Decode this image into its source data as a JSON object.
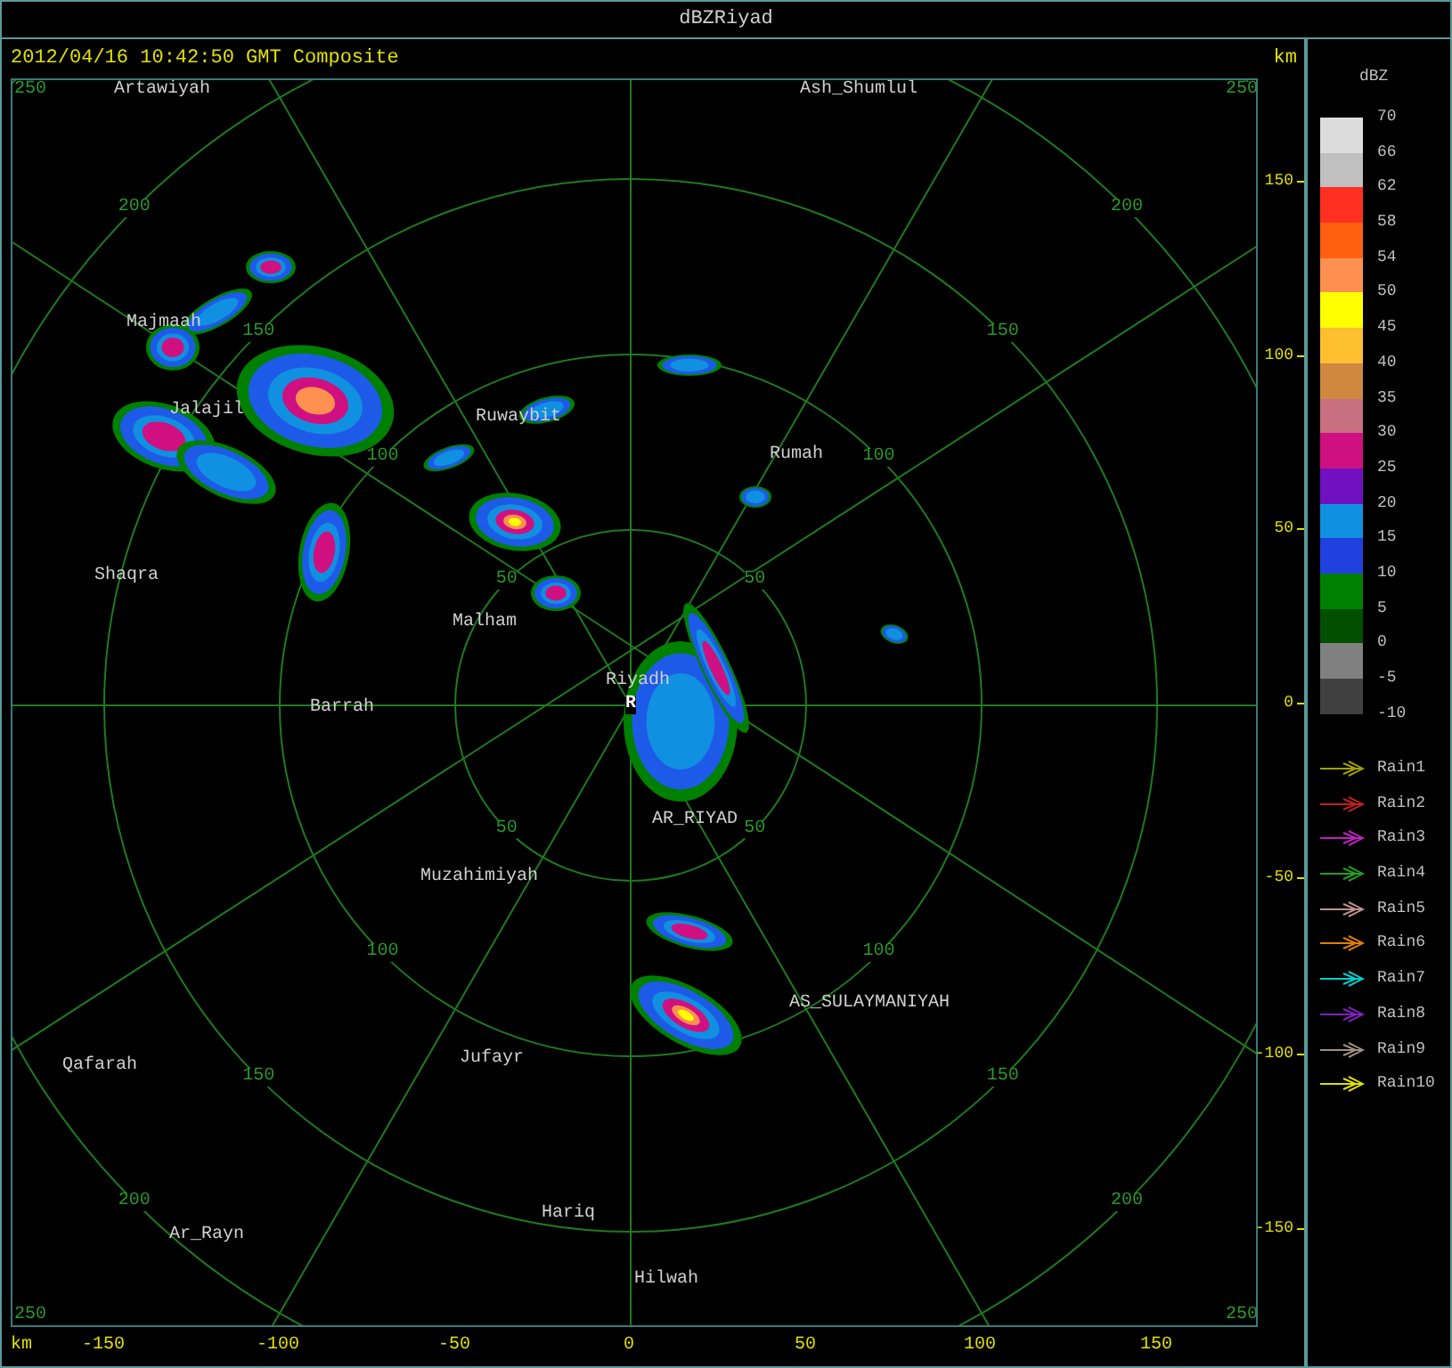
{
  "window": {
    "title": "dBZRiyad"
  },
  "header": {
    "timestamp": "2012/04/16 10:42:50 GMT Composite",
    "unit": "km"
  },
  "radar": {
    "site": "R",
    "rings": [
      {
        "labels": [
          "50",
          "50",
          "50",
          "50"
        ]
      },
      {
        "labels": [
          "100",
          "100",
          "100",
          "100"
        ]
      },
      {
        "labels": [
          "150",
          "150",
          "150",
          "150"
        ]
      },
      {
        "labels": [
          "200",
          "200",
          "200",
          "200"
        ]
      },
      {
        "labels": [
          "250",
          "250",
          "250",
          "250"
        ]
      }
    ],
    "places": [
      "Artawiyah",
      "Ash_Shumlul",
      "Majmaah",
      "Jalajil",
      "Ruwaybit",
      "Rumah",
      "Shaqra",
      "Malham",
      "Riyadh",
      "Barrah",
      "AR_RIYAD",
      "Muzahimiyah",
      "AS_SULAYMANIYAH",
      "Jufayr",
      "Qafarah",
      "Hariq",
      "Ar_Rayn",
      "Hilwah"
    ]
  },
  "y_axis": {
    "labels": [
      "150",
      "100",
      "50",
      "0",
      "-50",
      "-100",
      "-150"
    ]
  },
  "x_axis": {
    "unit": "km",
    "labels": [
      "-150",
      "-100",
      "-50",
      "0",
      "50",
      "100",
      "150"
    ]
  },
  "legend": {
    "title": "dBZ",
    "bottom_label": "-10",
    "scale": [
      {
        "label": "70",
        "color": "#dcdcdc"
      },
      {
        "label": "66",
        "color": "#c0c0c0"
      },
      {
        "label": "62",
        "color": "#ff3020"
      },
      {
        "label": "58",
        "color": "#ff6010"
      },
      {
        "label": "54",
        "color": "#ff9050"
      },
      {
        "label": "50",
        "color": "#ffff00"
      },
      {
        "label": "45",
        "color": "#ffc030"
      },
      {
        "label": "40",
        "color": "#d08840"
      },
      {
        "label": "35",
        "color": "#c87080"
      },
      {
        "label": "30",
        "color": "#d01080"
      },
      {
        "label": "25",
        "color": "#7010c0"
      },
      {
        "label": "20",
        "color": "#1090e0"
      },
      {
        "label": "15",
        "color": "#2040e0"
      },
      {
        "label": "10",
        "color": "#008000"
      },
      {
        "label": "5",
        "color": "#005000"
      },
      {
        "label": "0",
        "color": "#808080"
      },
      {
        "label": "-5",
        "color": "#404040"
      }
    ],
    "tracks": [
      {
        "label": "Rain1",
        "color": "#a0a000"
      },
      {
        "label": "Rain2",
        "color": "#c02020"
      },
      {
        "label": "Rain3",
        "color": "#c020c0"
      },
      {
        "label": "Rain4",
        "color": "#20a020"
      },
      {
        "label": "Rain5",
        "color": "#c09090"
      },
      {
        "label": "Rain6",
        "color": "#e08000"
      },
      {
        "label": "Rain7",
        "color": "#00d0d0"
      },
      {
        "label": "Rain8",
        "color": "#8020c0"
      },
      {
        "label": "Rain9",
        "color": "#a09080"
      },
      {
        "label": "Rain10",
        "color": "#e0e000"
      }
    ]
  }
}
